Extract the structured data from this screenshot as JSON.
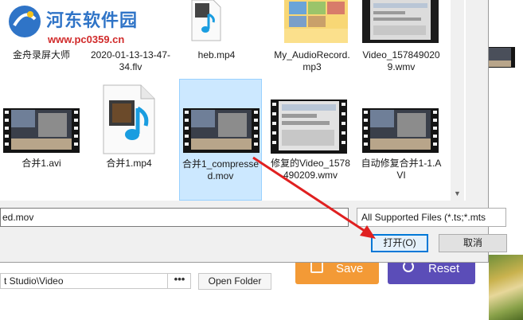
{
  "watermark": {
    "site_name": "河东软件园",
    "url": "www.pc0359.cn"
  },
  "files": [
    {
      "name": "金舟录屏大师",
      "thumb": "app-icon"
    },
    {
      "name": "2020-01-13-13-47-34.flv",
      "thumb": "document-icon"
    },
    {
      "name": "heb.mp4",
      "thumb": "media-file-icon"
    },
    {
      "name": "My_AudioRecord.mp3",
      "thumb": "folder-icon"
    },
    {
      "name": "Video_1578490209.wmv",
      "thumb": "video-thumb-icon"
    },
    {
      "name": "合并1.avi",
      "thumb": "video-thumb-icon"
    },
    {
      "name": "合并1.mp4",
      "thumb": "media-file-icon"
    },
    {
      "name": "合并1_compressed.mov",
      "thumb": "video-thumb-icon",
      "selected": true
    },
    {
      "name": "修复的Video_1578490209.wmv",
      "thumb": "video-thumb-icon"
    },
    {
      "name": "自动修复合并1-1.AVI",
      "thumb": "video-thumb-icon"
    }
  ],
  "dialog": {
    "filename_value": "ed.mov",
    "filetype_value": "All Supported Files (*.ts;*.mts",
    "open_label": "打开(O)",
    "cancel_label": "取消"
  },
  "app": {
    "path_value": "t Studio\\Video",
    "path_dots": "•••",
    "open_folder_label": "Open Folder",
    "save_label": "Save",
    "reset_label": "Reset"
  },
  "colors": {
    "selection": "#cce8ff",
    "accent": "#0078d7",
    "save": "#f39a36",
    "reset": "#5b4db8",
    "annotation_arrow": "#e02020"
  }
}
